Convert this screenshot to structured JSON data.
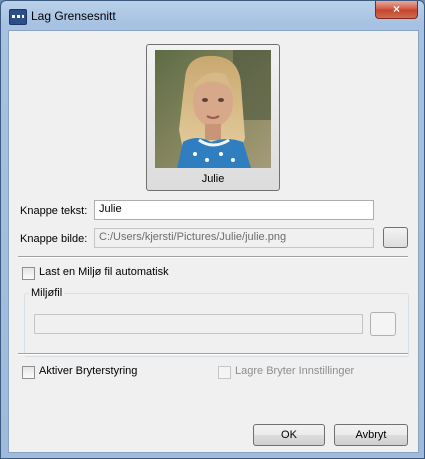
{
  "window": {
    "title": "Lag Grensesnitt",
    "close_label": "×"
  },
  "portrait": {
    "caption": "Julie",
    "icon": "portrait-photo"
  },
  "button_text": {
    "label": "Knappe tekst:",
    "value": "Julie"
  },
  "button_image": {
    "label": "Knappe bilde:",
    "value": "C:/Users/kjersti/Pictures/Julie/julie.png"
  },
  "auto_load": {
    "label": "Last en Miljø fil automatisk",
    "checked": false
  },
  "env_group": {
    "title": "Miljøfil",
    "path": ""
  },
  "switch_control": {
    "label": "Aktiver Bryterstyring",
    "checked": false
  },
  "save_switch": {
    "label": "Lagre Bryter Innstillinger",
    "checked": false
  },
  "actions": {
    "ok": "OK",
    "cancel": "Avbryt"
  },
  "colors": {
    "titlebar": "#a6c1e1",
    "close": "#c2442b",
    "dialog": "#f0f0f0"
  }
}
